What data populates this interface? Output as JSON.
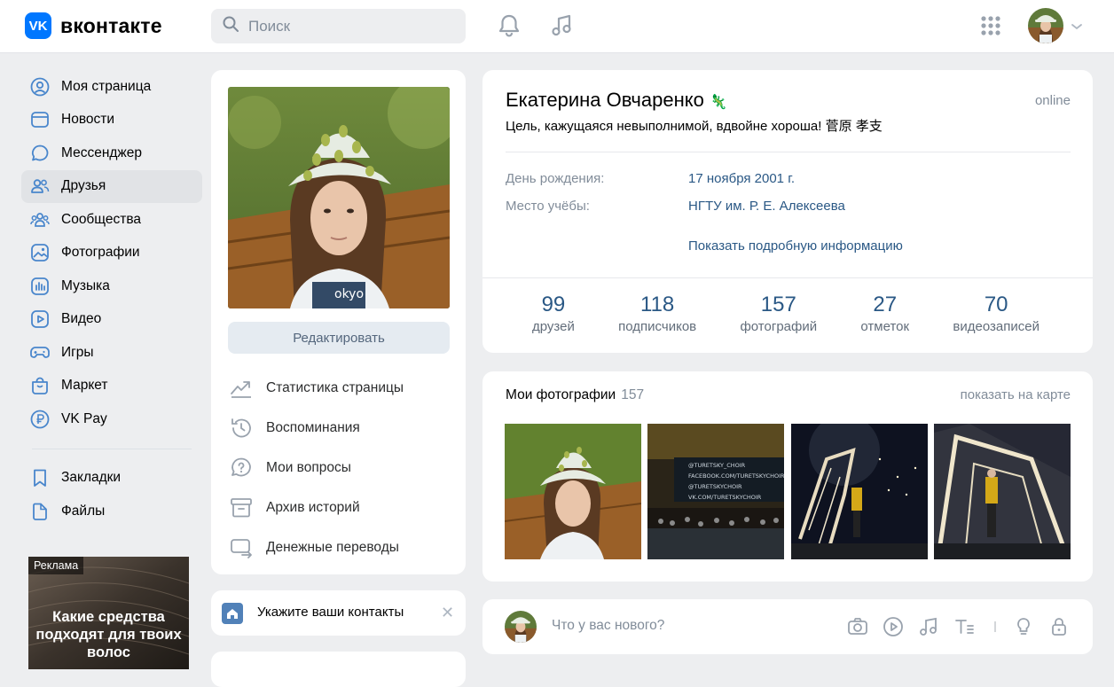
{
  "header": {
    "logo_mark": "VK",
    "logo_text": "вконтакте",
    "search_placeholder": "Поиск",
    "icons": [
      "bell-icon",
      "music-icon",
      "apps-grid-icon",
      "chevron-down-icon"
    ]
  },
  "sidebar": {
    "items": [
      {
        "label": "Моя страница",
        "icon": "user-circle-icon"
      },
      {
        "label": "Новости",
        "icon": "news-icon"
      },
      {
        "label": "Мессенджер",
        "icon": "message-icon"
      },
      {
        "label": "Друзья",
        "icon": "friends-icon",
        "active": true
      },
      {
        "label": "Сообщества",
        "icon": "communities-icon"
      },
      {
        "label": "Фотографии",
        "icon": "photo-icon"
      },
      {
        "label": "Музыка",
        "icon": "music-icon"
      },
      {
        "label": "Видео",
        "icon": "video-icon"
      },
      {
        "label": "Игры",
        "icon": "gamepad-icon"
      },
      {
        "label": "Маркет",
        "icon": "market-icon"
      },
      {
        "label": "VK Pay",
        "icon": "vkpay-icon"
      }
    ],
    "items2": [
      {
        "label": "Закладки",
        "icon": "bookmark-icon"
      },
      {
        "label": "Файлы",
        "icon": "file-icon"
      }
    ],
    "ad": {
      "tag": "Реклама",
      "text": "Какие средства подходят для твоих волос"
    }
  },
  "profile_menu": {
    "edit_label": "Редактировать",
    "items": [
      {
        "label": "Статистика страницы",
        "icon": "stats-icon"
      },
      {
        "label": "Воспоминания",
        "icon": "history-icon"
      },
      {
        "label": "Мои вопросы",
        "icon": "question-icon"
      },
      {
        "label": "Архив историй",
        "icon": "archive-icon"
      },
      {
        "label": "Денежные переводы",
        "icon": "money-transfer-icon"
      }
    ],
    "contacts_label": "Укажите ваши контакты"
  },
  "profile": {
    "name": "Екатерина Овчаренко",
    "emoji": "🦎",
    "online": "online",
    "status": "Цель, кажущаяся невыполнимой, вдвойне хороша! 菅原 孝支",
    "birthday_label": "День рождения:",
    "birthday_value": "17 ноября 2001 г.",
    "study_label": "Место учёбы:",
    "study_value": "НГТУ им. Р. Е. Алексеева",
    "more_label": "Показать подробную информацию",
    "counters": [
      {
        "n": "99",
        "label": "друзей"
      },
      {
        "n": "118",
        "label": "подписчиков"
      },
      {
        "n": "157",
        "label": "фотографий"
      },
      {
        "n": "27",
        "label": "отметок"
      },
      {
        "n": "70",
        "label": "видеозаписей"
      }
    ]
  },
  "photos": {
    "title": "Мои фотографии",
    "count": "157",
    "map_link": "показать на карте",
    "concert_lines": [
      "@TURETSKY_CHOIR",
      "FACEBOOK.COM/TURETSKYCHOIR",
      "@TURETSKYCHOIR",
      "VK.COM/TURETSKYCHOIR"
    ]
  },
  "post": {
    "placeholder": "Что у вас нового?",
    "icons": [
      "camera-icon",
      "video-play-icon",
      "music-note-icon",
      "text-format-icon",
      "idea-icon",
      "lock-icon"
    ]
  }
}
